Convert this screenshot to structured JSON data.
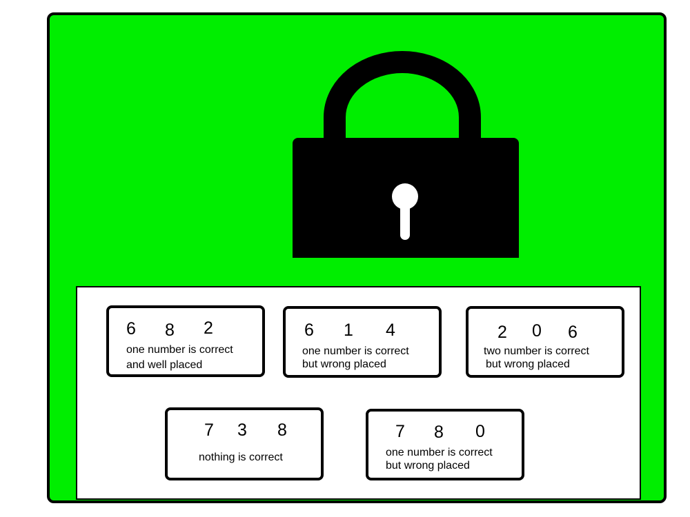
{
  "theme": {
    "background": "#00ee00",
    "lock_color": "#000000"
  },
  "lock": {
    "icon": "padlock-icon"
  },
  "clues": [
    {
      "digits": [
        "6",
        "8",
        "2"
      ],
      "line1": "one number is correct",
      "line2": "and well placed"
    },
    {
      "digits": [
        "6",
        "1",
        "4"
      ],
      "line1": "one number is correct",
      "line2": "but wrong placed"
    },
    {
      "digits": [
        "2",
        "0",
        "6"
      ],
      "line1": "two  number is correct",
      "line2": "but wrong placed"
    },
    {
      "digits": [
        "7",
        "3",
        "8"
      ],
      "line1": "nothing is correct",
      "line2": ""
    },
    {
      "digits": [
        "7",
        "8",
        "0"
      ],
      "line1": "one number is correct",
      "line2": "but wrong placed"
    }
  ]
}
